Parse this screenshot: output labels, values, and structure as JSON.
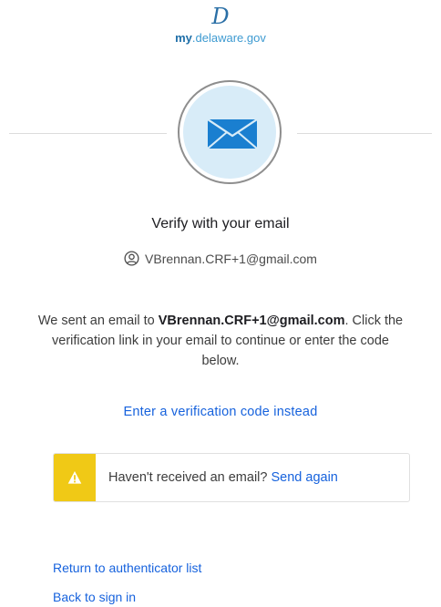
{
  "brand": {
    "logo_letter": "D",
    "site_prefix": "my",
    "site_rest": ".delaware.gov"
  },
  "authenticator": {
    "icon": "envelope-icon",
    "title": "Verify with your email",
    "identifier_icon": "user-circle-icon",
    "identifier": "VBrennan.CRF+1@gmail.com"
  },
  "message": {
    "prefix": "We sent an email to ",
    "email": "VBrennan.CRF+1@gmail.com",
    "suffix": ". Click the verification link in your email to continue or enter the code below."
  },
  "links": {
    "enter_code": "Enter a verification code instead",
    "return_list": "Return to authenticator list",
    "back_signin": "Back to sign in"
  },
  "callout": {
    "icon": "warning-icon",
    "text": "Haven't received an email?",
    "action": "Send again"
  },
  "colors": {
    "link": "#1662dd",
    "warning": "#f0c916",
    "badge_fill": "#d8ecf8",
    "envelope": "#1a7fd0"
  }
}
